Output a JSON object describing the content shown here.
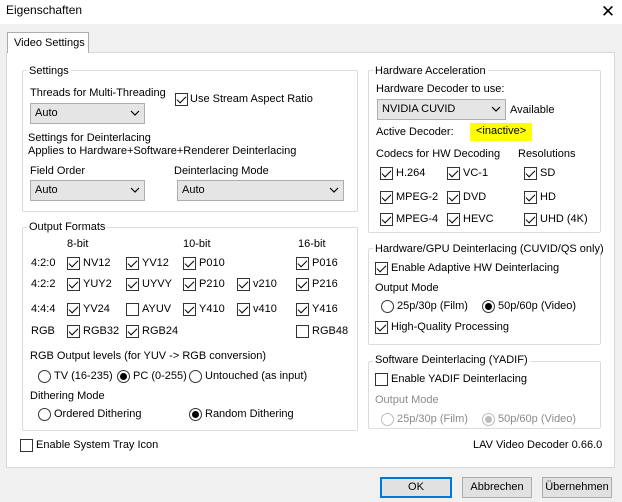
{
  "window": {
    "title": "Eigenschaften",
    "close": "✕"
  },
  "tabs": [
    {
      "label": "Video Settings"
    }
  ],
  "settings": {
    "title": "Settings",
    "threads_label": "Threads for Multi-Threading",
    "threads_value": "Auto",
    "stream_aspect_label": "Use Stream Aspect Ratio",
    "stream_aspect_checked": true,
    "deint_title": "Settings for Deinterlacing",
    "deint_subtitle": "Applies to Hardware+Software+Renderer Deinterlacing",
    "field_order_label": "Field Order",
    "field_order_value": "Auto",
    "deint_mode_label": "Deinterlacing Mode",
    "deint_mode_value": "Auto"
  },
  "output_formats": {
    "title": "Output Formats",
    "col_8bit": "8-bit",
    "col_10bit": "10-bit",
    "col_16bit": "16-bit",
    "row_420": "4:2:0",
    "row_422": "4:2:2",
    "row_444": "4:4:4",
    "row_rgb": "RGB",
    "formats": {
      "nv12": {
        "label": "NV12",
        "checked": true
      },
      "yv12": {
        "label": "YV12",
        "checked": true
      },
      "p010": {
        "label": "P010",
        "checked": true
      },
      "p016": {
        "label": "P016",
        "checked": true
      },
      "yuy2": {
        "label": "YUY2",
        "checked": true
      },
      "uyvy": {
        "label": "UYVY",
        "checked": true
      },
      "p210": {
        "label": "P210",
        "checked": true
      },
      "v210": {
        "label": "v210",
        "checked": true
      },
      "p216": {
        "label": "P216",
        "checked": true
      },
      "yv24": {
        "label": "YV24",
        "checked": true
      },
      "ayuv": {
        "label": "AYUV",
        "checked": false
      },
      "y410": {
        "label": "Y410",
        "checked": true
      },
      "v410": {
        "label": "v410",
        "checked": true
      },
      "y416": {
        "label": "Y416",
        "checked": true
      },
      "rgb32": {
        "label": "RGB32",
        "checked": true
      },
      "rgb24": {
        "label": "RGB24",
        "checked": true
      },
      "rgb48": {
        "label": "RGB48",
        "checked": false
      }
    },
    "rgb_levels_label": "RGB Output levels (for YUV -> RGB conversion)",
    "rgb_levels": [
      {
        "label": "TV (16-235)",
        "checked": false
      },
      {
        "label": "PC (0-255)",
        "checked": true
      },
      {
        "label": "Untouched (as input)",
        "checked": false
      }
    ],
    "dithering_label": "Dithering Mode",
    "dithering": [
      {
        "label": "Ordered Dithering",
        "checked": false
      },
      {
        "label": "Random Dithering",
        "checked": true
      }
    ]
  },
  "systray": {
    "label": "Enable System Tray Icon",
    "checked": false
  },
  "hw_accel": {
    "title": "Hardware Acceleration",
    "decoder_label": "Hardware Decoder to use:",
    "decoder_value": "NVIDIA CUVID",
    "decoder_status": "Available",
    "active_label": "Active Decoder:",
    "active_value": "<inactive>",
    "highlight_color": "#ffff00",
    "codecs_label": "Codecs for HW Decoding",
    "resolutions_label": "Resolutions",
    "codecs": [
      {
        "label": "H.264",
        "checked": true
      },
      {
        "label": "VC-1",
        "checked": true
      },
      {
        "label": "MPEG-2",
        "checked": true
      },
      {
        "label": "DVD",
        "checked": true
      },
      {
        "label": "MPEG-4",
        "checked": true
      },
      {
        "label": "HEVC",
        "checked": true
      }
    ],
    "resolutions": [
      {
        "label": "SD",
        "checked": true
      },
      {
        "label": "HD",
        "checked": true
      },
      {
        "label": "UHD (4K)",
        "checked": true
      }
    ]
  },
  "hw_deint": {
    "title": "Hardware/GPU Deinterlacing (CUVID/QS only)",
    "adaptive_label": "Enable Adaptive HW Deinterlacing",
    "adaptive_checked": true,
    "output_mode_label": "Output Mode",
    "film_label": "25p/30p (Film)",
    "film_checked": false,
    "video_label": "50p/60p (Video)",
    "video_checked": true,
    "hq_label": "High-Quality Processing",
    "hq_checked": true
  },
  "sw_deint": {
    "title": "Software Deinterlacing (YADIF)",
    "yadif_label": "Enable YADIF Deinterlacing",
    "yadif_checked": false,
    "output_mode_label": "Output Mode",
    "film_label": "25p/30p (Film)",
    "video_label": "50p/60p (Video)",
    "video_checked": true
  },
  "version": "LAV Video Decoder 0.66.0",
  "buttons": {
    "ok": "OK",
    "cancel": "Abbrechen",
    "apply": "Übernehmen"
  },
  "icons": {
    "dropdown": "chevron-down-icon",
    "close": "close-icon"
  }
}
